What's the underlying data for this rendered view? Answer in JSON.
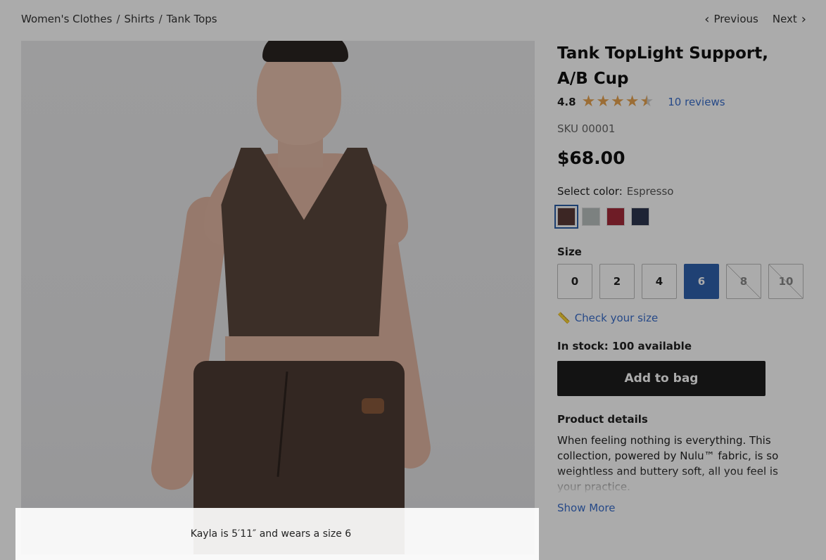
{
  "breadcrumb": {
    "items": [
      "Women's Clothes",
      "Shirts",
      "Tank Tops"
    ],
    "separator": "/"
  },
  "pager": {
    "previous": "Previous",
    "next": "Next"
  },
  "product": {
    "title": "Tank TopLight Support, A/B Cup",
    "rating": "4.8",
    "stars": 4.8,
    "reviews_label": "10 reviews",
    "sku": "SKU 00001",
    "price": "$68.00",
    "color_label": "Select color:",
    "color_value": "Espresso",
    "swatches": [
      {
        "name": "espresso",
        "hex": "#5a3a36",
        "selected": true
      },
      {
        "name": "grey-sage",
        "hex": "#b9c0bf",
        "selected": false
      },
      {
        "name": "burgundy",
        "hex": "#a42a3a",
        "selected": false
      },
      {
        "name": "navy",
        "hex": "#2e3650",
        "selected": false
      }
    ],
    "size_label": "Size",
    "sizes": [
      "0",
      "2",
      "4",
      "6",
      "8",
      "10"
    ],
    "selected_size": "6",
    "out_of_stock_sizes": [
      "8",
      "10"
    ],
    "check_size": "Check your size",
    "stock": "In stock: 100 available",
    "add_to_bag": "Add to bag",
    "details_title": "Product details",
    "details_text": "When feeling nothing is everything. This collection, powered by Nulu™ fabric, is so weightless and buttery soft, all you feel is your practice.",
    "show_more": "Show More"
  },
  "image": {
    "caption": "Kayla is 5′11″ and wears a size 6"
  },
  "colors": {
    "accent": "#2f62ad",
    "link": "#3a6ecb",
    "star": "#e8a34f",
    "button": "#1d1d1d"
  }
}
